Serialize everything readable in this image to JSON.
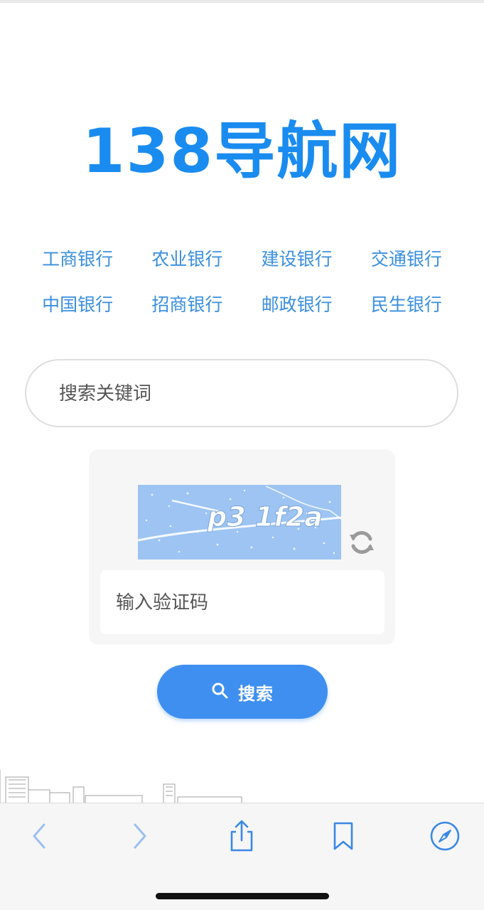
{
  "logo": {
    "text": "138导航网",
    "color": "#1a8cf0"
  },
  "bank_links": [
    "工商银行",
    "农业银行",
    "建设银行",
    "交通银行",
    "中国银行",
    "招商银行",
    "邮政银行",
    "民生银行"
  ],
  "search": {
    "placeholder": "搜索关键词",
    "value": ""
  },
  "captcha": {
    "image_text": "p3 1f2a",
    "refresh_icon": "refresh-icon",
    "input_placeholder": "输入验证码",
    "input_value": ""
  },
  "search_button": {
    "label": "搜索",
    "icon": "search-icon",
    "color": "#3f8ff0"
  },
  "browser_toolbar": {
    "back_icon": "chevron-left-icon",
    "forward_icon": "chevron-right-icon",
    "share_icon": "share-icon",
    "bookmarks_icon": "bookmark-icon",
    "safari_icon": "compass-icon",
    "accent_color": "#3a88e6"
  }
}
